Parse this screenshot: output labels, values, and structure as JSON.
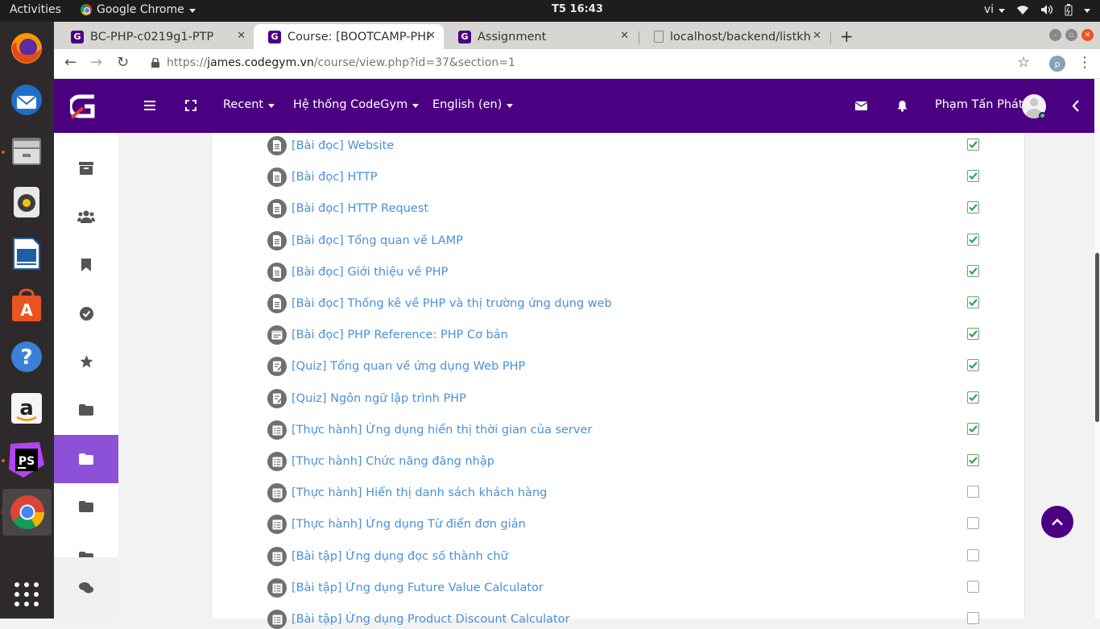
{
  "system": {
    "activities": "Activities",
    "app_name": "Google Chrome",
    "clock": "T5 16:43",
    "lang": "vi"
  },
  "tabs": [
    {
      "title": "BC-PHP-c0219g1-PTP",
      "favicon": "codegym-logo"
    },
    {
      "title": "Course: [BOOTCAMP-PHP",
      "favicon": "codegym-logo"
    },
    {
      "title": "Assignment",
      "favicon": "codegym-logo"
    },
    {
      "title": "localhost/backend/listkh",
      "favicon": "page-icon"
    }
  ],
  "address_bar": {
    "scheme": "https://",
    "host": "james.codegym.vn",
    "path": "/course/view.php?id=37&section=1",
    "profile_initial": "p"
  },
  "header": {
    "menus": [
      "Recent",
      "Hệ thống CodeGym",
      "English (en)"
    ],
    "user_name": "Phạm Tấn Phát"
  },
  "activities": [
    {
      "label": "[Bài đọc] Website",
      "icon": "page-icon",
      "done": true
    },
    {
      "label": "[Bài đọc] HTTP",
      "icon": "page-icon",
      "done": true
    },
    {
      "label": "[Bài đọc] HTTP Request",
      "icon": "page-icon",
      "done": true
    },
    {
      "label": "[Bài đọc] Tổng quan về LAMP",
      "icon": "page-icon",
      "done": true
    },
    {
      "label": "[Bài đọc] Giới thiệu về PHP",
      "icon": "page-icon",
      "done": true
    },
    {
      "label": "[Bài đọc] Thống kê về PHP và thị trường ứng dụng web",
      "icon": "page-icon",
      "done": true
    },
    {
      "label": "[Bài đọc] PHP Reference: PHP Cơ bản",
      "icon": "url-icon",
      "done": true
    },
    {
      "label": "[Quiz] Tổng quan về ứng dụng Web PHP",
      "icon": "quiz-icon",
      "done": true
    },
    {
      "label": "[Quiz] Ngôn ngữ lập trình PHP",
      "icon": "quiz-icon",
      "done": true
    },
    {
      "label": "[Thực hành] Ứng dụng hiển thị thời gian của server",
      "icon": "assignment-icon",
      "done": true
    },
    {
      "label": "[Thực hành] Chức năng đăng nhập",
      "icon": "assignment-icon",
      "done": true
    },
    {
      "label": "[Thực hành] Hiển thị danh sách khách hàng",
      "icon": "assignment-icon",
      "done": false
    },
    {
      "label": "[Thực hành] Ứng dụng Từ điển đơn giản",
      "icon": "assignment-icon",
      "done": false
    },
    {
      "label": "[Bài tập] Ứng dụng đọc số thành chữ",
      "icon": "assignment-icon",
      "done": false
    },
    {
      "label": "[Bài tập] Ứng dụng Future Value Calculator",
      "icon": "assignment-icon",
      "done": false
    },
    {
      "label": "[Bài tập] Ứng dụng Product Discount Calculator",
      "icon": "assignment-icon",
      "done": false
    }
  ],
  "colors": {
    "brand": "#4b0082",
    "drawer_active": "#8c51d6",
    "link": "#4a90d9",
    "check": "#2aa34a"
  }
}
